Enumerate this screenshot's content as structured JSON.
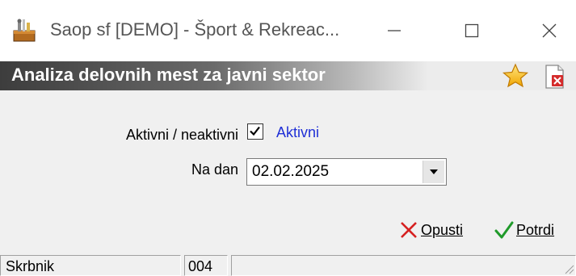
{
  "window": {
    "title": "Saop sf [DEMO] - Šport & Rekreac...",
    "app_icon": "toolbox-icon",
    "controls": [
      "minimize-icon",
      "maximize-icon",
      "close-icon"
    ]
  },
  "header": {
    "title": "Analiza delovnih mest za javni sektor",
    "icons": [
      "star-icon",
      "close-document-icon"
    ]
  },
  "form": {
    "active_label": "Aktivni / neaktivni",
    "active_checkbox": {
      "checked": true,
      "label": "Aktivni"
    },
    "date_label": "Na dan",
    "date_value": "02.02.2025"
  },
  "actions": {
    "cancel_label": "Opusti",
    "confirm_label": "Potrdi"
  },
  "statusbar": {
    "user": "Skrbnik",
    "code": "004",
    "extra": ""
  },
  "colors": {
    "checkbox_label": "#1f2fd6",
    "cancel_icon": "#d62020",
    "confirm_icon": "#1f9a2a",
    "header_text": "#ffffff"
  }
}
